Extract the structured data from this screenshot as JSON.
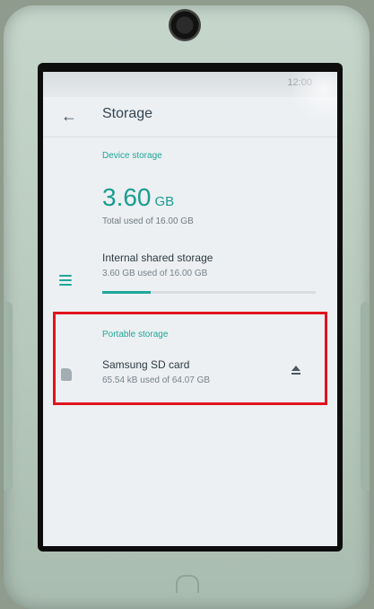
{
  "status_bar": {
    "right_text": "12:00"
  },
  "appbar": {
    "title": "Storage",
    "back_icon": "arrow-back-icon"
  },
  "device_storage": {
    "section_label": "Device storage",
    "used_value": "3.60",
    "used_unit": "GB",
    "total_text": "Total used of 16.00 GB",
    "internal": {
      "title": "Internal shared storage",
      "subtitle": "3.60 GB used of 16.00 GB",
      "progress_fraction": 0.225,
      "icon": "storage-list-icon"
    }
  },
  "portable_storage": {
    "section_label": "Portable storage",
    "card": {
      "title": "Samsung SD card",
      "subtitle": "65.54 kB used of 64.07 GB",
      "icon": "sd-card-icon",
      "action_icon": "eject-icon"
    }
  },
  "colors": {
    "accent": "#1fa79a",
    "highlight_border": "#e0141e",
    "frame": "#b7c9bd",
    "background": "#ecf0f2"
  }
}
